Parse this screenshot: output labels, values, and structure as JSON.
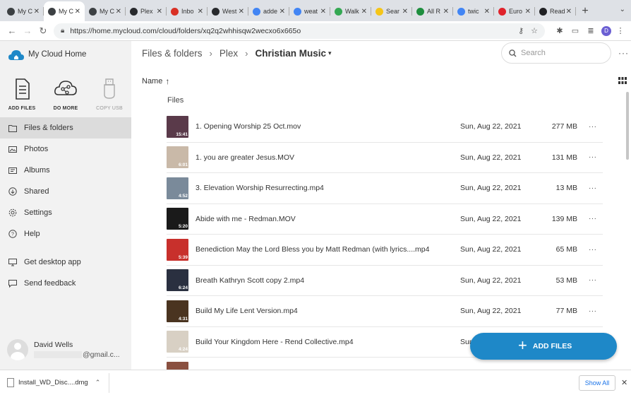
{
  "browser": {
    "tabs": [
      {
        "label": "My C",
        "icon": "wordpress-icon",
        "active": false
      },
      {
        "label": "My C",
        "icon": "wordpress-icon",
        "active": true
      },
      {
        "label": "My C",
        "icon": "wordpress-icon",
        "active": false
      },
      {
        "label": "Plex",
        "icon": "plex-icon",
        "active": false
      },
      {
        "label": "Inbo",
        "icon": "gmail-icon",
        "active": false
      },
      {
        "label": "West",
        "icon": "plex-icon",
        "active": false
      },
      {
        "label": "adde",
        "icon": "google-icon",
        "active": false
      },
      {
        "label": "weat",
        "icon": "google-icon",
        "active": false
      },
      {
        "label": "Walk",
        "icon": "maps-icon",
        "active": false
      },
      {
        "label": "Sear",
        "icon": "d-icon",
        "active": false
      },
      {
        "label": "All R",
        "icon": "d-green-icon",
        "active": false
      },
      {
        "label": "twic",
        "icon": "google-icon",
        "active": false
      },
      {
        "label": "Euro",
        "icon": "opera-icon",
        "active": false
      },
      {
        "label": "Read",
        "icon": "news-icon",
        "active": false
      }
    ],
    "url": "https://home.mycloud.com/cloud/folders/xq2q2whhisqw2wecxo6x665o",
    "profile_initial": "D"
  },
  "brand": {
    "name": "My Cloud Home",
    "color": "#1e88c8"
  },
  "quick_actions": [
    {
      "label": "ADD FILES",
      "icon": "document-icon"
    },
    {
      "label": "DO MORE",
      "icon": "cloud-network-icon"
    },
    {
      "label": "COPY USB",
      "icon": "usb-icon"
    }
  ],
  "nav": [
    {
      "label": "Files & folders",
      "icon": "folder-icon",
      "active": true
    },
    {
      "label": "Photos",
      "icon": "photo-icon"
    },
    {
      "label": "Albums",
      "icon": "album-icon"
    },
    {
      "label": "Shared",
      "icon": "shared-icon"
    },
    {
      "label": "Settings",
      "icon": "gear-icon"
    },
    {
      "label": "Help",
      "icon": "help-icon"
    },
    {
      "label": "Get desktop app",
      "icon": "monitor-icon"
    },
    {
      "label": "Send feedback",
      "icon": "feedback-icon"
    }
  ],
  "user": {
    "name": "David Wells",
    "email_suffix": "@gmail.c..."
  },
  "breadcrumb": {
    "root": "Files & folders",
    "middle": "Plex",
    "current": "Christian Music"
  },
  "search": {
    "placeholder": "Search"
  },
  "sort": {
    "label": "Name"
  },
  "section_label": "Files",
  "files": [
    {
      "name": "1. Opening Worship 25 Oct.mov",
      "date": "Sun, Aug 22, 2021",
      "size": "277 MB",
      "duration": "15:41",
      "thumb_color": "#5a3a4a"
    },
    {
      "name": "1. you are greater Jesus.MOV",
      "date": "Sun, Aug 22, 2021",
      "size": "131 MB",
      "duration": "6:01",
      "thumb_color": "#c9b9a8"
    },
    {
      "name": "3. Elevation Worship Resurrecting.mp4",
      "date": "Sun, Aug 22, 2021",
      "size": "13 MB",
      "duration": "4:52",
      "thumb_color": "#7a8a9a"
    },
    {
      "name": "Abide with me - Redman.MOV",
      "date": "Sun, Aug 22, 2021",
      "size": "139 MB",
      "duration": "5:20",
      "thumb_color": "#1a1a1a"
    },
    {
      "name": "Benediction May the Lord Bless you by Matt Redman (with lyrics....mp4",
      "date": "Sun, Aug 22, 2021",
      "size": "65 MB",
      "duration": "5:39",
      "thumb_color": "#c8302c"
    },
    {
      "name": "Breath Kathryn Scott copy 2.mp4",
      "date": "Sun, Aug 22, 2021",
      "size": "53 MB",
      "duration": "6:24",
      "thumb_color": "#2a3040"
    },
    {
      "name": "Build My Life Lent Version.mp4",
      "date": "Sun, Aug 22, 2021",
      "size": "77 MB",
      "duration": "4:31",
      "thumb_color": "#4a3420"
    },
    {
      "name": "Build Your Kingdom Here - Rend Collective.mp4",
      "date": "Sun, Aug 22, 2021",
      "size": "",
      "duration": "4:24",
      "thumb_color": "#d8d0c4"
    },
    {
      "name": "",
      "date": "",
      "size": "",
      "duration": "",
      "thumb_color": "#8a5040"
    }
  ],
  "fab": {
    "label": "ADD FILES"
  },
  "download": {
    "filename": "Install_WD_Disc....dmg",
    "show_all": "Show All"
  }
}
